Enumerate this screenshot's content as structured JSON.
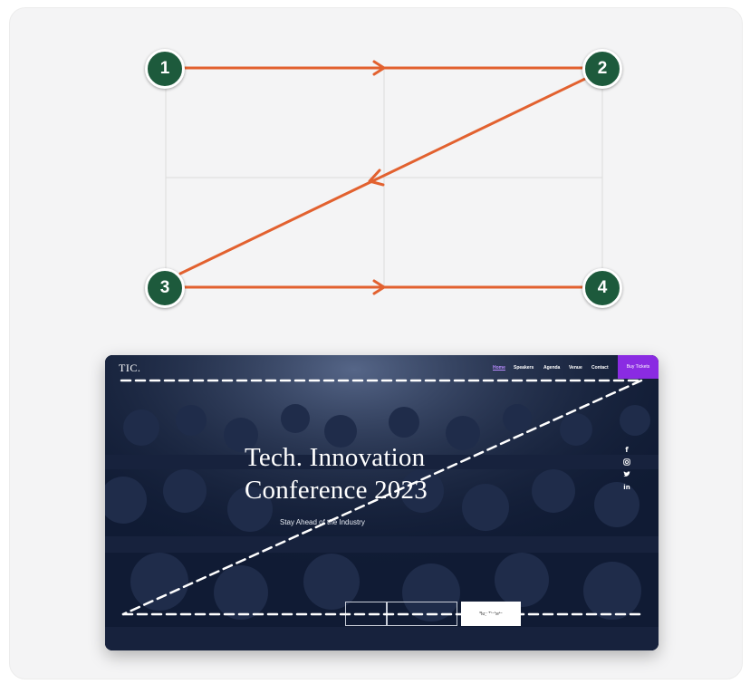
{
  "steps": [
    "1",
    "2",
    "3",
    "4"
  ],
  "colors": {
    "card_bg": "#f4f4f5",
    "arrow": "#e2612f",
    "badge": "#1d5a3c",
    "grid": "#dcdcdc",
    "site_bg": "#0f1a32",
    "accent": "#8a2be2",
    "dash": "#ffffff"
  },
  "site": {
    "logo": "TIC.",
    "nav": [
      "Home",
      "Speakers",
      "Agenda",
      "Venue",
      "Contact"
    ],
    "cta": "Buy Tickets",
    "title_line1": "Tech. Innovation",
    "title_line2": "Conference 2023",
    "subtitle": "Stay Ahead of the Industry",
    "social_icons": [
      "facebook-icon",
      "instagram-icon",
      "twitter-icon",
      "linkedin-icon"
    ],
    "button_secondary": "",
    "button_primary": "Buy Tickets"
  }
}
